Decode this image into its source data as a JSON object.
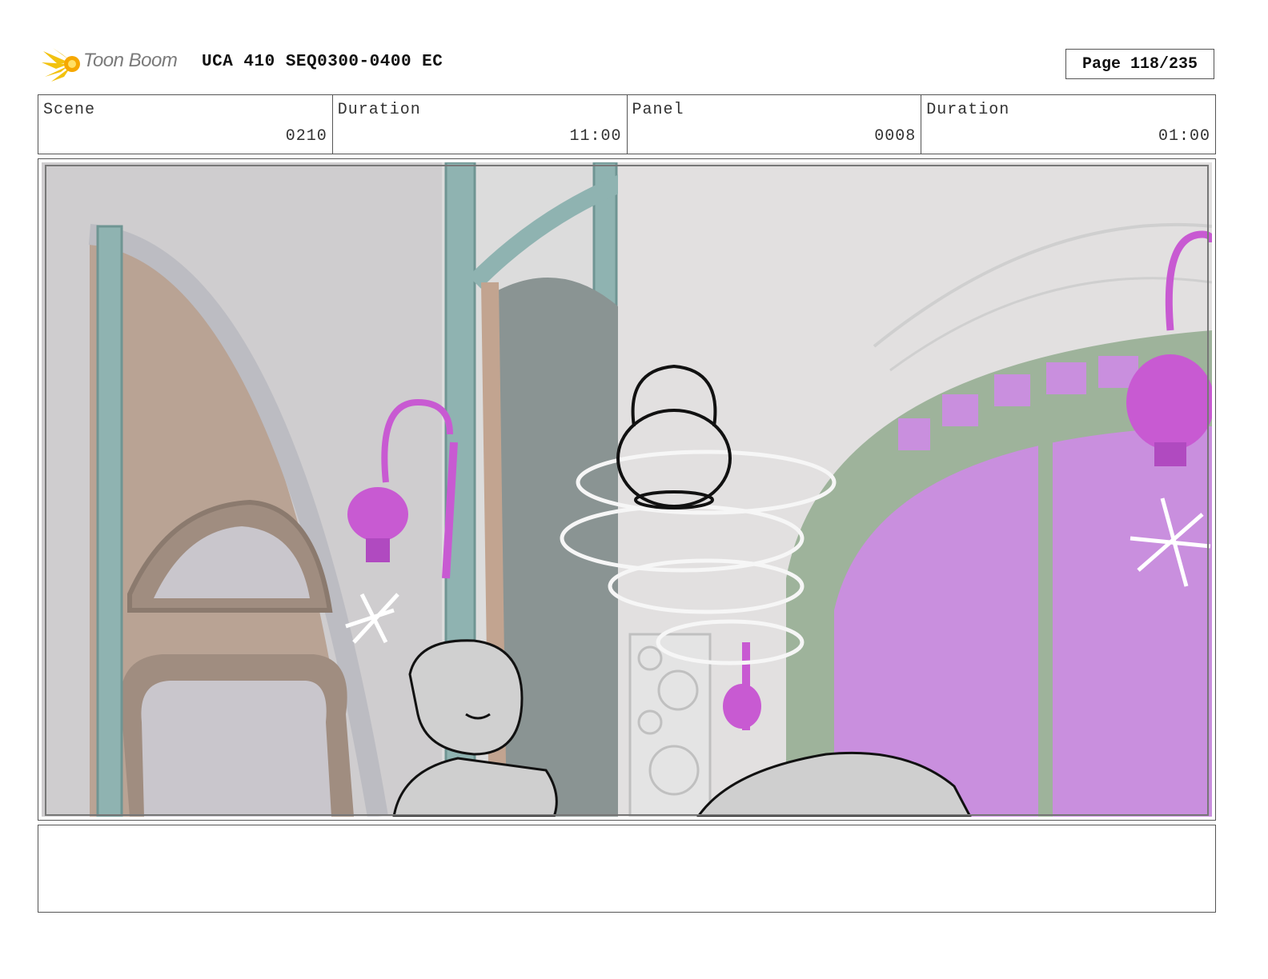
{
  "header": {
    "brand_name": "Toon Boom",
    "title": "UCA 410 SEQ0300-0400 EC",
    "page": "Page 118/235"
  },
  "info": {
    "scene_label": "Scene",
    "scene_value": "0210",
    "scene_duration_label": "Duration",
    "scene_duration_value": "11:00",
    "panel_label": "Panel",
    "panel_value": "0008",
    "panel_duration_label": "Duration",
    "panel_duration_value": "01:00"
  },
  "notes": {
    "text": ""
  },
  "colors": {
    "accent_magenta": "#c85ad2",
    "teal_pillar": "#8fb3b1",
    "brown_arch": "#b9a394",
    "logo_yellow": "#f2c20f"
  }
}
